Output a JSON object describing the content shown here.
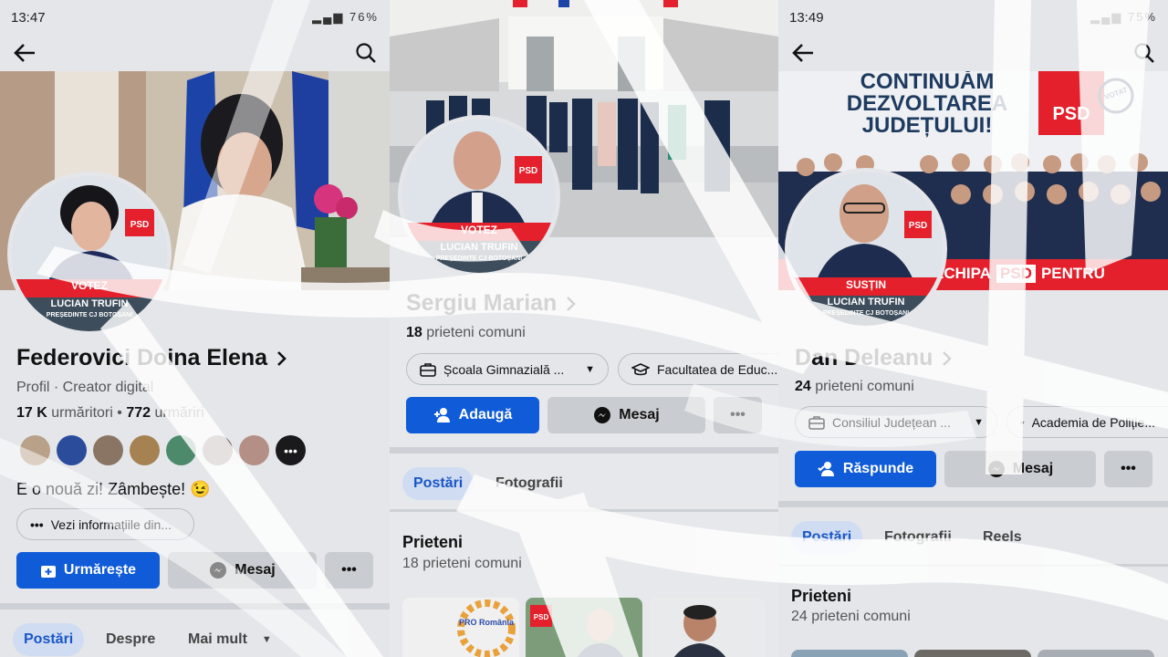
{
  "panel1": {
    "status": {
      "time": "13:47",
      "battery": "76%"
    },
    "avatar_band": {
      "line1": "VOTEZ",
      "line2": "LUCIAN TRUFIN",
      "line3": "PREȘEDINTE CJ BOTOȘANI"
    },
    "psd_badge": "PSD",
    "name": "Federovici Doina Elena",
    "profile_line": "Profil · Creator digital",
    "followers_count": "17 K",
    "followers_label": "urmăritori",
    "following_count": "772",
    "following_label": "urmăriri",
    "bio": "E o nouă zi! Zâmbește!",
    "emoji": "😉",
    "info_pill": "Vezi informațiile din...",
    "follow_button": "Urmărește",
    "message_button": "Mesaj",
    "tabs": [
      "Postări",
      "Despre",
      "Mai mult"
    ]
  },
  "panel2": {
    "avatar_band": {
      "line1": "VOTEZ",
      "line2": "LUCIAN TRUFIN",
      "line3": "PREȘEDINTE CJ BOTOȘANI"
    },
    "psd_badge": "PSD",
    "name": "Sergiu Marian",
    "mutual_count": "18",
    "mutual_label": "prieteni comuni",
    "school_pill": "Școala Gimnazială ...",
    "faculty_pill": "Facultatea de Educ...",
    "add_button": "Adaugă",
    "message_button": "Mesaj",
    "tabs": [
      "Postări",
      "Fotografii"
    ],
    "friends_title": "Prieteni",
    "friends_sub": "18 prieteni comuni",
    "thumb1_text": "PRO România",
    "thumb2_badge": "PSD"
  },
  "panel3": {
    "status": {
      "time": "13:49",
      "battery": "75%"
    },
    "banner_line1": "CONTINUĂM",
    "banner_line2": "DEZVOLTAREA",
    "banner_line3": "JUDEȚULUI!",
    "banner_psd": "PSD",
    "banner_votat": "VOTAT",
    "banner_bottom_left": "ECHIPA",
    "banner_bottom_psd": "PSD",
    "banner_bottom_right": "PENTRU",
    "avatar_band": {
      "line1": "SUSȚIN",
      "line2": "LUCIAN TRUFIN",
      "line3": "PREȘEDINTE CJ BOTOȘANI"
    },
    "psd_badge": "PSD",
    "name": "Dan Deleanu",
    "mutual_count": "24",
    "mutual_label": "prieteni comuni",
    "work_pill": "Consiliul Județean ...",
    "academy_pill": "Academia de Poliție...",
    "respond_button": "Răspunde",
    "message_button": "Mesaj",
    "tabs": [
      "Postări",
      "Fotografii",
      "Reels"
    ],
    "friends_title": "Prieteni",
    "friends_sub": "24 prieteni comuni"
  },
  "colors": {
    "accent": "#0f5bd8",
    "psd_red": "#e3202b",
    "band_dark": "#3d4d5c"
  }
}
